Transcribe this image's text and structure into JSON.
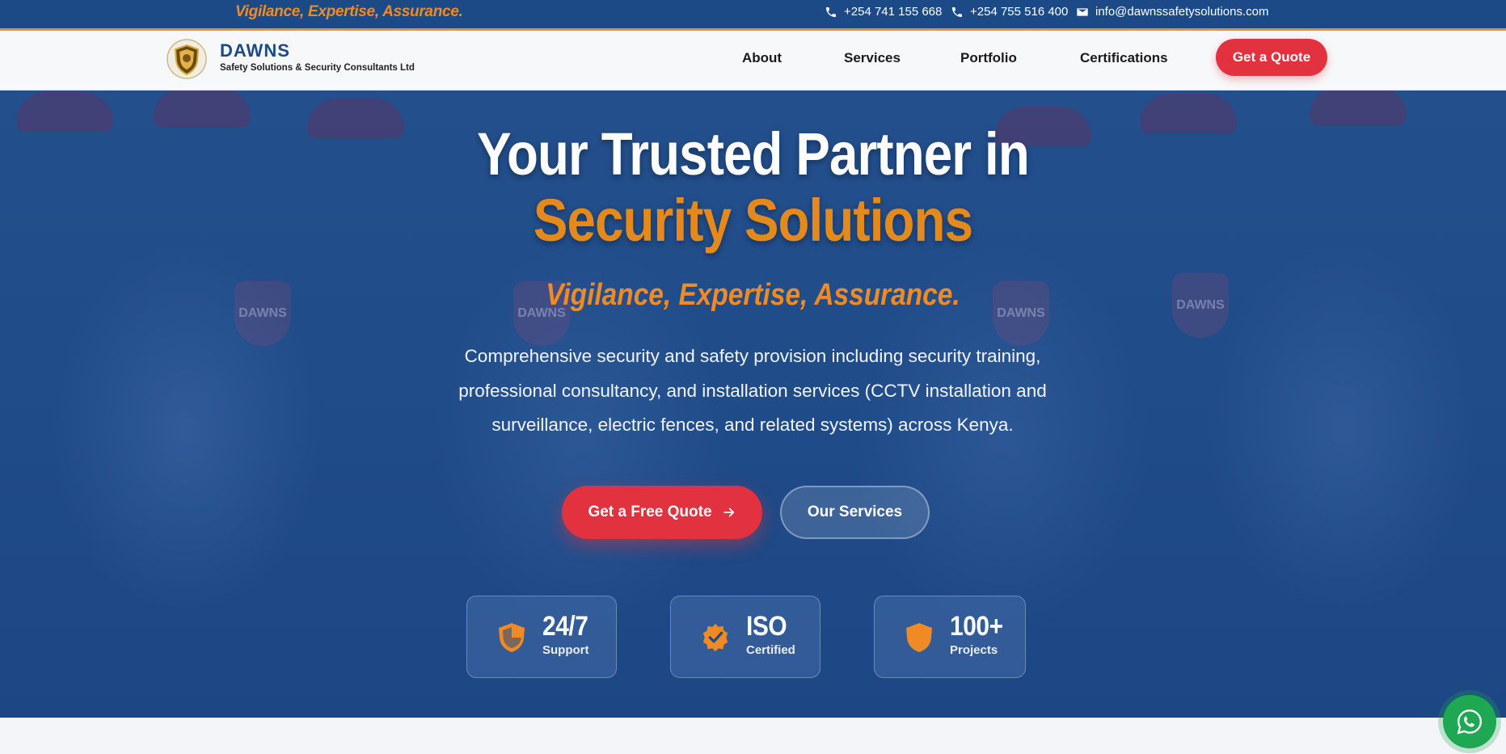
{
  "topbar": {
    "tagline": "Vigilance, Expertise, Assurance.",
    "phone1": "+254 741 155 668",
    "phone2": "+254 755 516 400",
    "email": "info@dawnssafetysolutions.com"
  },
  "brand": {
    "name": "DAWNS",
    "subtitle": "Safety Solutions & Security Consultants Ltd"
  },
  "nav": {
    "items": [
      "About",
      "Services",
      "Portfolio",
      "Certifications"
    ],
    "cta": "Get a Quote"
  },
  "hero": {
    "title_line1": "Your Trusted Partner in",
    "title_line2": "Security Solutions",
    "tagline": "Vigilance, Expertise, Assurance.",
    "description": "Comprehensive security and safety provision including security training, professional consultancy, and installation services (CCTV installation and surveillance, electric fences, and related systems) across Kenya.",
    "primary_button": "Get a Free Quote",
    "secondary_button": "Our Services",
    "badge_text": "DAWNS"
  },
  "stats": [
    {
      "value": "24/7",
      "label": "Support",
      "icon": "shield-half-icon"
    },
    {
      "value": "ISO",
      "label": "Certified",
      "icon": "verified-badge-icon"
    },
    {
      "value": "100+",
      "label": "Projects",
      "icon": "shield-icon"
    }
  ],
  "colors": {
    "primary_blue": "#1c4a86",
    "accent_orange": "#f08a24",
    "cta_red": "#e3323f",
    "whatsapp_green": "#1da851"
  }
}
